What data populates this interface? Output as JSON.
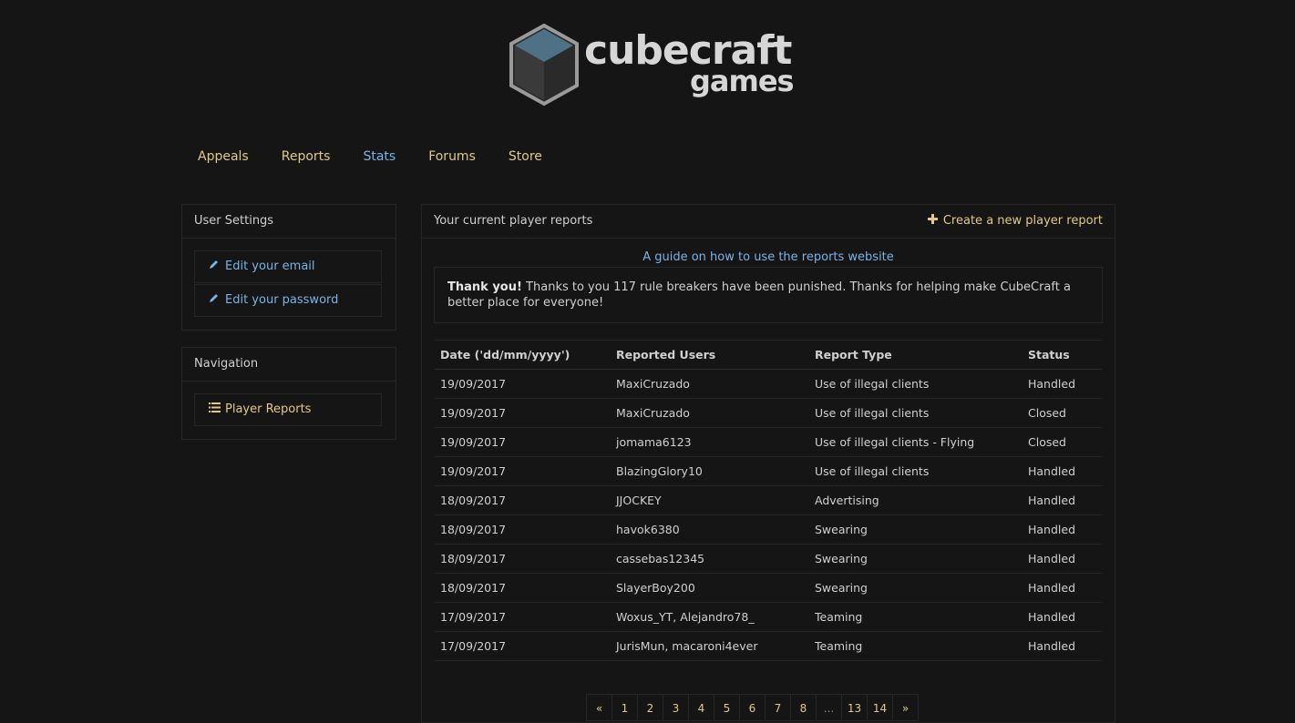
{
  "logo": {
    "word_top": "cubecraft",
    "word_bottom": "games"
  },
  "nav": [
    {
      "label": "Appeals",
      "active": false
    },
    {
      "label": "Reports",
      "active": false
    },
    {
      "label": "Stats",
      "active": true
    },
    {
      "label": "Forums",
      "active": false
    },
    {
      "label": "Store",
      "active": false
    }
  ],
  "user_settings": {
    "title": "User Settings",
    "items": [
      {
        "label": "Edit your email",
        "icon": "pencil-icon"
      },
      {
        "label": "Edit your password",
        "icon": "pencil-icon"
      }
    ]
  },
  "navigation": {
    "title": "Navigation",
    "items": [
      {
        "label": "Player Reports",
        "icon": "list-icon"
      }
    ]
  },
  "main": {
    "title": "Your current player reports",
    "create_label": "Create a new player report",
    "guide_label": "A guide on how to use the reports website",
    "thanks_bold": "Thank you!",
    "thanks_text": " Thanks to you 117 rule breakers have been punished. Thanks for helping make CubeCraft a better place for everyone!",
    "table": {
      "headers": [
        "Date ('dd/mm/yyyy')",
        "Reported Users",
        "Report Type",
        "Status"
      ],
      "rows": [
        [
          "19/09/2017",
          "MaxiCruzado",
          "Use of illegal clients",
          "Handled"
        ],
        [
          "19/09/2017",
          "MaxiCruzado",
          "Use of illegal clients",
          "Closed"
        ],
        [
          "19/09/2017",
          "jomama6123",
          "Use of illegal clients - Flying",
          "Closed"
        ],
        [
          "19/09/2017",
          "BlazingGlory10",
          "Use of illegal clients",
          "Handled"
        ],
        [
          "18/09/2017",
          "JJOCKEY",
          "Advertising",
          "Handled"
        ],
        [
          "18/09/2017",
          "havok6380",
          "Swearing",
          "Handled"
        ],
        [
          "18/09/2017",
          "cassebas12345",
          "Swearing",
          "Handled"
        ],
        [
          "18/09/2017",
          "SlayerBoy200",
          "Swearing",
          "Handled"
        ],
        [
          "17/09/2017",
          "Woxus_YT, Alejandro78_",
          "Teaming",
          "Handled"
        ],
        [
          "17/09/2017",
          "JurisMun, macaroni4ever",
          "Teaming",
          "Handled"
        ]
      ]
    },
    "pagination": [
      "«",
      "1",
      "2",
      "3",
      "4",
      "5",
      "6",
      "7",
      "8",
      "...",
      "13",
      "14",
      "»"
    ]
  },
  "colors": {
    "background": "#151515",
    "gold_link": "#e2c98a",
    "blue_link": "#7ab3e6"
  }
}
